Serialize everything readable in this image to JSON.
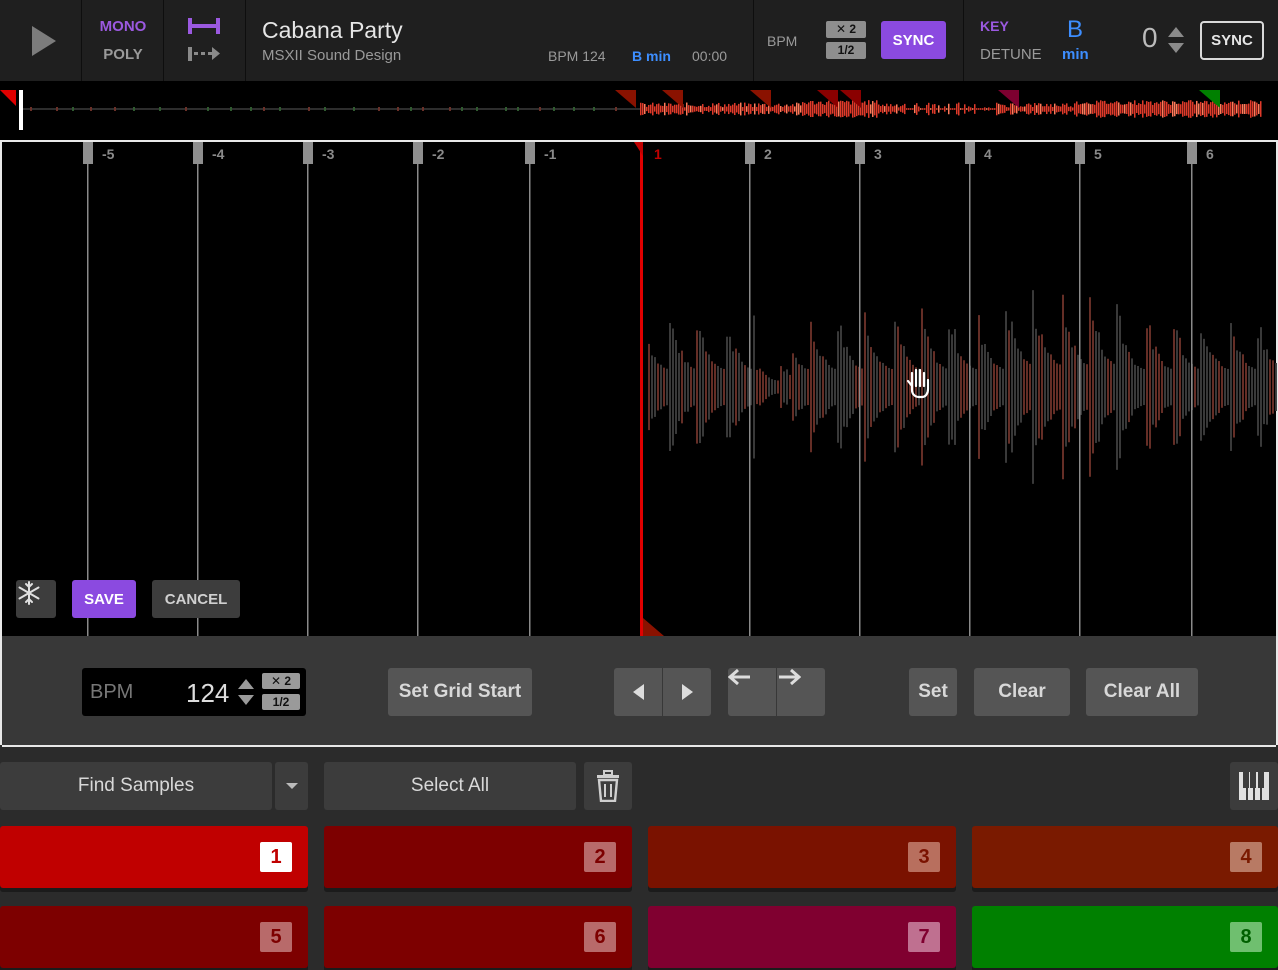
{
  "header": {
    "play_icon": "play-icon",
    "mono_label": "MONO",
    "poly_label": "POLY",
    "track": {
      "title": "Cabana Party",
      "artist": "MSXII Sound Design",
      "bpm": "BPM 124",
      "key": "B min",
      "time": "00:00"
    },
    "bpm_label": "BPM",
    "times_two": "✕ 2",
    "half": "1/2",
    "sync_label": "SYNC",
    "key_label": "KEY",
    "detune_label": "DETUNE",
    "key_note": "B",
    "key_mode": "min",
    "detune_value": "0",
    "sync2_label": "SYNC"
  },
  "editor": {
    "beats": [
      "-5",
      "-4",
      "-3",
      "-2",
      "-1",
      "1",
      "2",
      "3",
      "4",
      "5",
      "6"
    ],
    "save_label": "SAVE",
    "cancel_label": "CANCEL"
  },
  "controls": {
    "bpm_label": "BPM",
    "bpm_value": "124",
    "times_two": "✕ 2",
    "half": "1/2",
    "set_grid_start": "Set Grid Start",
    "set": "Set",
    "clear": "Clear",
    "clear_all": "Clear All"
  },
  "sample_bar": {
    "find_samples": "Find Samples",
    "select_all": "Select All"
  },
  "pads": [
    {
      "num": "1",
      "color": "#c00000",
      "badge": "#ffffff",
      "text": "#c00000"
    },
    {
      "num": "2",
      "color": "#7d0000",
      "badge": "#b86a6a",
      "text": "#7d0000"
    },
    {
      "num": "3",
      "color": "#7a1200",
      "badge": "#b86f5e",
      "text": "#7a1200"
    },
    {
      "num": "4",
      "color": "#7a1a00",
      "badge": "#b87a64",
      "text": "#7a1a00"
    },
    {
      "num": "5",
      "color": "#7d0000",
      "badge": "#b86a6a",
      "text": "#7d0000"
    },
    {
      "num": "6",
      "color": "#7d0000",
      "badge": "#b86a6a",
      "text": "#7d0000"
    },
    {
      "num": "7",
      "color": "#800030",
      "badge": "#bf7090",
      "text": "#800030"
    },
    {
      "num": "8",
      "color": "#008000",
      "badge": "#6fbf6f",
      "text": "#006000"
    }
  ],
  "colors": {
    "accent_purple": "#8b4ae0",
    "key_blue": "#3d8eff",
    "playhead_red": "#e00000"
  }
}
